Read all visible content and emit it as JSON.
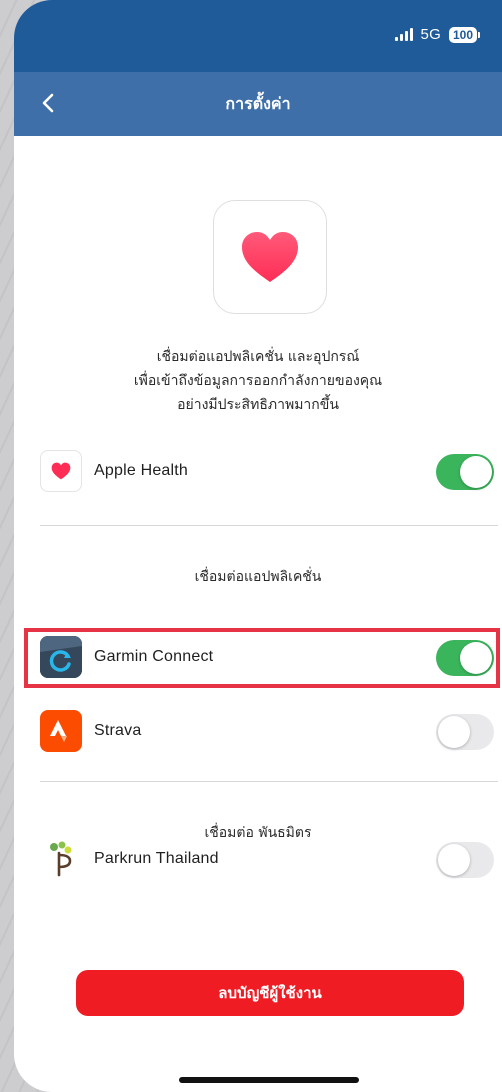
{
  "status_bar": {
    "network": "5G",
    "battery": "100"
  },
  "nav": {
    "title": "การตั้งค่า",
    "back_icon": "chevron-left-icon"
  },
  "intro": {
    "icon": "heart-icon",
    "lines": [
      "เชื่อมต่อแอปพลิเคชั่น และอุปกรณ์",
      "เพื่อเข้าถึงข้อมูลการออกกำลังกายของคุณ",
      "อย่างมีประสิทธิภาพมากขึ้น"
    ]
  },
  "apple_health": {
    "label": "Apple Health",
    "enabled": true
  },
  "apps_section": {
    "title": "เชื่อมต่อแอปพลิเคชั่น",
    "items": [
      {
        "label": "Garmin Connect",
        "enabled": true
      },
      {
        "label": "Strava",
        "enabled": false
      }
    ]
  },
  "partners_section": {
    "title": "เชื่อมต่อ พันธมิตร",
    "items": [
      {
        "label": "Parkrun Thailand",
        "enabled": false
      }
    ]
  },
  "delete_button": {
    "label": "ลบบัญชีผู้ใช้งาน"
  },
  "colors": {
    "status_bar": "#1f5a99",
    "nav_bar": "#3f6fa8",
    "toggle_on": "#3bb55c",
    "toggle_off": "#e9e9eb",
    "delete_button": "#f01c24",
    "highlight": "#e63446"
  }
}
